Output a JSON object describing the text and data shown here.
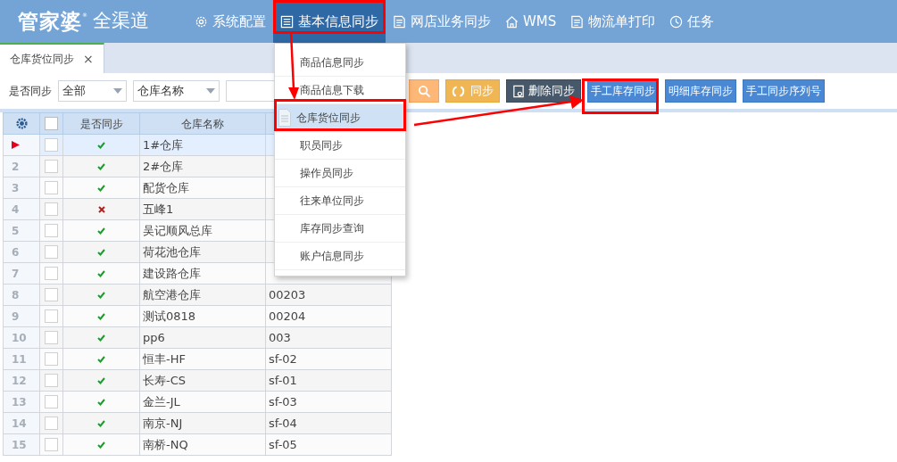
{
  "app": {
    "logo": "管家婆",
    "logo_mark": "®",
    "logo_sub": "全渠道"
  },
  "nav": [
    {
      "label": "系统配置",
      "kind": "gear",
      "selected": false
    },
    {
      "label": "基本信息同步",
      "kind": "list",
      "selected": true
    },
    {
      "label": "网店业务同步",
      "kind": "doc",
      "selected": false
    },
    {
      "label": "WMS",
      "kind": "home",
      "selected": false
    },
    {
      "label": "物流单打印",
      "kind": "doc",
      "selected": false
    },
    {
      "label": "任务",
      "kind": "clock",
      "selected": false
    }
  ],
  "tabs": [
    {
      "label": "仓库货位同步",
      "close": "×",
      "selected": true
    }
  ],
  "filters": {
    "label": "是否同步",
    "sync_select": "全部",
    "field_select": "仓库名称"
  },
  "toolbar": [
    {
      "kind": "search"
    },
    {
      "kind": "sync",
      "label": "同步"
    },
    {
      "kind": "delete",
      "label": "删除同步"
    },
    {
      "kind": "primary",
      "label": "手工库存同步"
    },
    {
      "kind": "primary",
      "label": "明细库存同步"
    },
    {
      "kind": "primary",
      "label": "手工同步序列号"
    }
  ],
  "table": {
    "columns": [
      "是否同步",
      "仓库名称"
    ],
    "all_checked": false,
    "rows": [
      {
        "selected": true,
        "checked": false,
        "synced": true,
        "name": "1#仓库"
      },
      {
        "number": "2",
        "selected": false,
        "checked": false,
        "synced": true,
        "name": "2#仓库"
      },
      {
        "number": "3",
        "selected": false,
        "checked": false,
        "synced": true,
        "name": "配货仓库"
      },
      {
        "number": "4",
        "selected": false,
        "checked": false,
        "synced": false,
        "name": "五峰1"
      },
      {
        "number": "5",
        "selected": false,
        "checked": false,
        "synced": true,
        "name": "吴记顺风总库"
      },
      {
        "number": "6",
        "selected": false,
        "checked": false,
        "synced": true,
        "name": "荷花池仓库"
      },
      {
        "number": "7",
        "selected": false,
        "checked": false,
        "synced": true,
        "name": "建设路仓库"
      },
      {
        "number": "8",
        "selected": false,
        "checked": false,
        "synced": true,
        "name": "航空港仓库",
        "code": "00203"
      },
      {
        "number": "9",
        "selected": false,
        "checked": false,
        "synced": true,
        "name": "测试0818",
        "code": "00204"
      },
      {
        "number": "10",
        "selected": false,
        "checked": false,
        "synced": true,
        "name": "pp6",
        "code": "003"
      },
      {
        "number": "11",
        "selected": false,
        "checked": false,
        "synced": true,
        "name": "恒丰-HF",
        "code": "sf-02"
      },
      {
        "number": "12",
        "selected": false,
        "checked": false,
        "synced": true,
        "name": "长寿-CS",
        "code": "sf-01"
      },
      {
        "number": "13",
        "selected": false,
        "checked": false,
        "synced": true,
        "name": "金兰-JL",
        "code": "sf-03"
      },
      {
        "number": "14",
        "selected": false,
        "checked": false,
        "synced": true,
        "name": "南京-NJ",
        "code": "sf-04"
      },
      {
        "number": "15",
        "selected": false,
        "checked": false,
        "synced": true,
        "name": "南桥-NQ",
        "code": "sf-05"
      }
    ]
  },
  "menu": {
    "items": [
      {
        "label": "商品信息同步",
        "selected": false
      },
      {
        "label": "商品信息下载",
        "selected": false
      },
      {
        "label": "仓库货位同步",
        "selected": true
      },
      {
        "label": "职员同步",
        "selected": false
      },
      {
        "label": "操作员同步",
        "selected": false
      },
      {
        "label": "往来单位同步",
        "selected": false
      },
      {
        "label": "库存同步查询",
        "selected": false
      },
      {
        "label": "账户信息同步",
        "selected": false
      }
    ]
  }
}
